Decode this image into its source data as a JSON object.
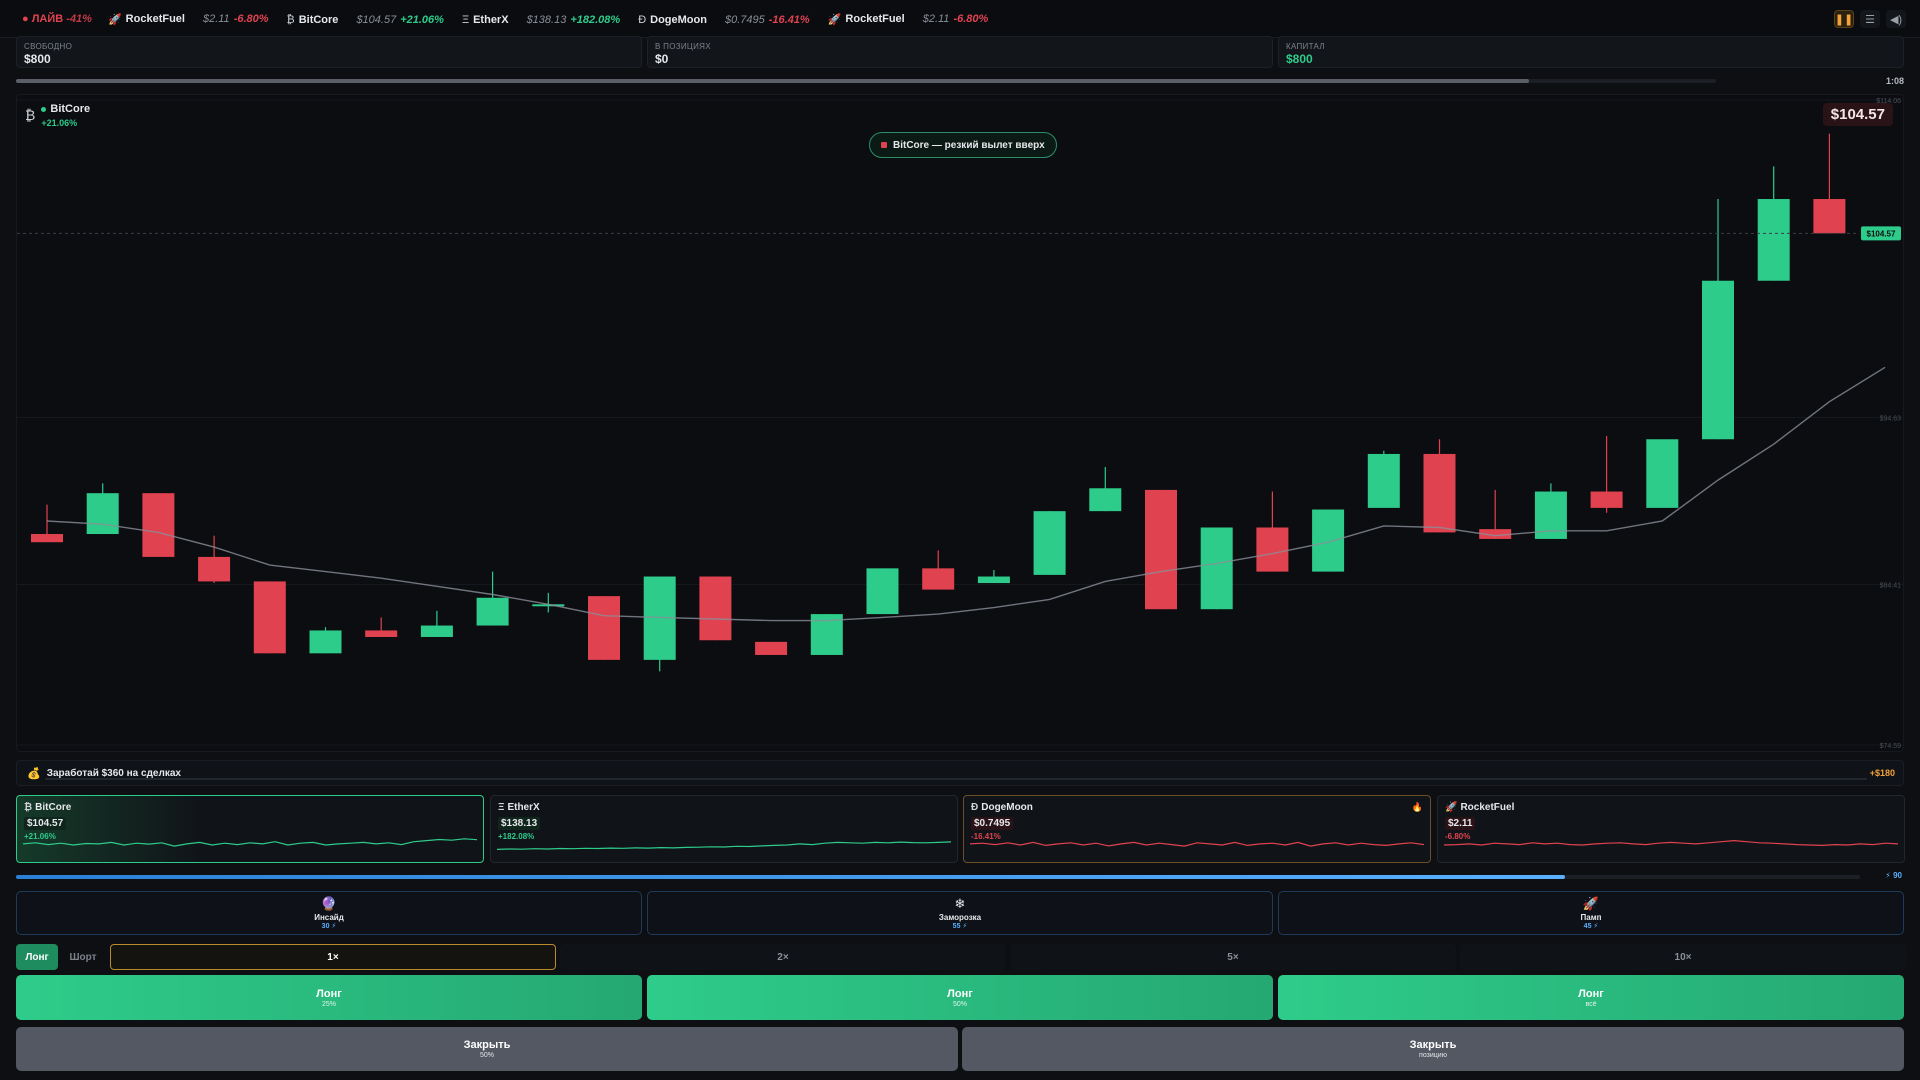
{
  "ticker": {
    "live_label": "● ЛАЙВ",
    "live_pct": "-41%",
    "items": [
      {
        "icon": "rocket-icon",
        "glyph": "🚀",
        "name": "RocketFuel",
        "price": "$2.11",
        "change": "-6.80%",
        "dir": "neg"
      },
      {
        "icon": "bitcore-icon",
        "glyph": "₿",
        "name": "BitCore",
        "price": "$104.57",
        "change": "+21.06%",
        "dir": "pos"
      },
      {
        "icon": "etherx-icon",
        "glyph": "Ξ",
        "name": "EtherX",
        "price": "$138.13",
        "change": "+182.08%",
        "dir": "pos"
      },
      {
        "icon": "dogemoon-icon",
        "glyph": "Ð",
        "name": "DogeMoon",
        "price": "$0.7495",
        "change": "-16.41%",
        "dir": "neg"
      },
      {
        "icon": "rocket-icon",
        "glyph": "🚀",
        "name": "RocketFuel",
        "price": "$2.11",
        "change": "-6.80%",
        "dir": "neg"
      }
    ]
  },
  "stats": {
    "free": {
      "label": "СВОБОДНО",
      "value": "$800"
    },
    "positions": {
      "label": "В ПОЗИЦИЯХ",
      "value": "$0"
    },
    "capital": {
      "label": "КАПИТАЛ",
      "value": "$800"
    }
  },
  "timer": "1:08",
  "round_progress": 0.89,
  "chart": {
    "asset_symbol": "₿",
    "asset_name": "BitCore",
    "asset_change": "+21.06%",
    "current_price": "$104.57",
    "current_price_tag": "$104.57",
    "news": "BitCore — резкий вылет вверх",
    "colors": {
      "up": "#2ecc8a",
      "down": "#e0434f",
      "ma": "#8a8f98"
    }
  },
  "chart_data": {
    "type": "candlestick",
    "y_ticks": [
      "$114.06",
      "$94.63",
      "$84.41",
      "$74.59"
    ],
    "y_tick_values": [
      114.06,
      94.63,
      84.41,
      74.59
    ],
    "ylim": [
      74.59,
      114.06
    ],
    "candles": [
      {
        "o": 87.5,
        "h": 89.3,
        "l": 87.0,
        "c": 87.0
      },
      {
        "o": 87.5,
        "h": 90.6,
        "l": 87.5,
        "c": 90.0
      },
      {
        "o": 90.0,
        "h": 90.0,
        "l": 86.1,
        "c": 86.1
      },
      {
        "o": 86.1,
        "h": 87.4,
        "l": 84.5,
        "c": 84.6
      },
      {
        "o": 84.6,
        "h": 84.6,
        "l": 80.2,
        "c": 80.2
      },
      {
        "o": 80.2,
        "h": 81.8,
        "l": 80.2,
        "c": 81.6
      },
      {
        "o": 81.6,
        "h": 82.4,
        "l": 81.2,
        "c": 81.2
      },
      {
        "o": 81.2,
        "h": 82.8,
        "l": 81.2,
        "c": 81.9
      },
      {
        "o": 81.9,
        "h": 85.2,
        "l": 81.9,
        "c": 83.6
      },
      {
        "o": 83.1,
        "h": 83.9,
        "l": 82.7,
        "c": 83.2
      },
      {
        "o": 83.7,
        "h": 83.7,
        "l": 79.8,
        "c": 79.8
      },
      {
        "o": 79.8,
        "h": 84.9,
        "l": 79.1,
        "c": 84.9
      },
      {
        "o": 84.9,
        "h": 84.9,
        "l": 81.0,
        "c": 81.0
      },
      {
        "o": 80.9,
        "h": 80.9,
        "l": 80.1,
        "c": 80.1
      },
      {
        "o": 80.1,
        "h": 82.6,
        "l": 80.1,
        "c": 82.6
      },
      {
        "o": 82.6,
        "h": 85.4,
        "l": 82.6,
        "c": 85.4
      },
      {
        "o": 85.4,
        "h": 86.5,
        "l": 84.1,
        "c": 84.1
      },
      {
        "o": 84.5,
        "h": 85.3,
        "l": 84.5,
        "c": 84.9
      },
      {
        "o": 85.0,
        "h": 88.9,
        "l": 85.0,
        "c": 88.9
      },
      {
        "o": 88.9,
        "h": 91.6,
        "l": 88.9,
        "c": 90.3
      },
      {
        "o": 90.2,
        "h": 90.2,
        "l": 82.9,
        "c": 82.9
      },
      {
        "o": 82.9,
        "h": 87.9,
        "l": 82.9,
        "c": 87.9
      },
      {
        "o": 87.9,
        "h": 90.1,
        "l": 85.2,
        "c": 85.2
      },
      {
        "o": 85.2,
        "h": 89.0,
        "l": 85.2,
        "c": 89.0
      },
      {
        "o": 89.1,
        "h": 92.6,
        "l": 89.1,
        "c": 92.4
      },
      {
        "o": 92.4,
        "h": 93.3,
        "l": 87.6,
        "c": 87.6
      },
      {
        "o": 87.8,
        "h": 90.2,
        "l": 87.2,
        "c": 87.2
      },
      {
        "o": 87.2,
        "h": 90.6,
        "l": 87.2,
        "c": 90.1
      },
      {
        "o": 90.1,
        "h": 93.5,
        "l": 88.8,
        "c": 89.1
      },
      {
        "o": 89.1,
        "h": 93.0,
        "l": 89.1,
        "c": 93.3
      },
      {
        "o": 93.3,
        "h": 108.0,
        "l": 93.3,
        "c": 103.0
      },
      {
        "o": 103.0,
        "h": 110.0,
        "l": 103.0,
        "c": 108.0
      },
      {
        "o": 108.0,
        "h": 112.0,
        "l": 105.9,
        "c": 105.9
      }
    ],
    "moving_average": [
      88.3,
      88.1,
      87.6,
      86.7,
      85.6,
      85.2,
      84.8,
      84.3,
      83.8,
      83.2,
      82.5,
      82.4,
      82.3,
      82.2,
      82.2,
      82.4,
      82.6,
      83.0,
      83.5,
      84.6,
      85.2,
      85.7,
      86.3,
      87.0,
      88.0,
      87.9,
      87.4,
      87.7,
      87.7,
      88.3,
      90.8,
      93.0,
      95.6,
      97.7
    ]
  },
  "quest": {
    "icon": "money-bag-icon",
    "glyph": "💰",
    "text": "Заработай $360 на сделках",
    "reward": "+$180",
    "progress": 0.0
  },
  "cards": [
    {
      "symbol": "₿",
      "name": "BitCore",
      "price": "$104.57",
      "change": "+21.06%",
      "dir": "pos",
      "sparkline": [
        0.55,
        0.6,
        0.52,
        0.58,
        0.5,
        0.57,
        0.55,
        0.62,
        0.5,
        0.58,
        0.54,
        0.6,
        0.45,
        0.55,
        0.62,
        0.5,
        0.58,
        0.52,
        0.6,
        0.55,
        0.65,
        0.5,
        0.58,
        0.62,
        0.5,
        0.55,
        0.58,
        0.62,
        0.55,
        0.6,
        0.52,
        0.65,
        0.7,
        0.75,
        0.72,
        0.78,
        0.74
      ]
    },
    {
      "symbol": "Ξ",
      "name": "EtherX",
      "price": "$138.13",
      "change": "+182.08%",
      "dir": "pos",
      "sparkline": [
        0.3,
        0.32,
        0.31,
        0.33,
        0.32,
        0.34,
        0.33,
        0.35,
        0.34,
        0.36,
        0.35,
        0.37,
        0.36,
        0.38,
        0.37,
        0.39,
        0.4,
        0.42,
        0.41,
        0.44,
        0.43,
        0.46,
        0.48,
        0.5,
        0.55,
        0.52,
        0.58,
        0.62,
        0.6,
        0.58,
        0.62,
        0.6,
        0.63,
        0.61,
        0.6,
        0.62,
        0.64
      ]
    },
    {
      "symbol": "Ð",
      "name": "DogeMoon",
      "price": "$0.7495",
      "change": "-16.41%",
      "dir": "neg",
      "hot": true,
      "sparkline": [
        0.55,
        0.58,
        0.52,
        0.6,
        0.5,
        0.62,
        0.48,
        0.55,
        0.6,
        0.5,
        0.58,
        0.46,
        0.55,
        0.62,
        0.5,
        0.58,
        0.52,
        0.45,
        0.6,
        0.55,
        0.5,
        0.62,
        0.48,
        0.55,
        0.58,
        0.5,
        0.62,
        0.45,
        0.55,
        0.6,
        0.5,
        0.58,
        0.52,
        0.48,
        0.55,
        0.6,
        0.52
      ]
    },
    {
      "symbol": "🚀",
      "name": "RocketFuel",
      "price": "$2.11",
      "change": "-6.80%",
      "dir": "neg",
      "sparkline": [
        0.5,
        0.52,
        0.55,
        0.5,
        0.58,
        0.55,
        0.52,
        0.6,
        0.55,
        0.58,
        0.52,
        0.5,
        0.55,
        0.58,
        0.6,
        0.55,
        0.52,
        0.58,
        0.62,
        0.58,
        0.55,
        0.6,
        0.65,
        0.7,
        0.65,
        0.6,
        0.58,
        0.55,
        0.52,
        0.5,
        0.48,
        0.52,
        0.5,
        0.55,
        0.52,
        0.58,
        0.55
      ]
    }
  ],
  "energy": {
    "value": 0.84,
    "label": "⚡ 90"
  },
  "powerups": [
    {
      "icon": "crystal-ball-icon",
      "glyph": "🔮",
      "name": "Инсайд",
      "cost": "30 ⚡"
    },
    {
      "icon": "snowflake-icon",
      "glyph": "❄",
      "name": "Заморозка",
      "cost": "55 ⚡"
    },
    {
      "icon": "rocket-icon",
      "glyph": "🚀",
      "name": "Памп",
      "cost": "45 ⚡"
    }
  ],
  "direction": {
    "long": "Лонг",
    "short": "Шорт"
  },
  "leverage": [
    "1×",
    "2×",
    "5×",
    "10×"
  ],
  "actions": [
    {
      "label": "Лонг",
      "sub": "25%"
    },
    {
      "label": "Лонг",
      "sub": "50%"
    },
    {
      "label": "Лонг",
      "sub": "всё"
    }
  ],
  "close": [
    {
      "label": "Закрыть",
      "sub": "50%"
    },
    {
      "label": "Закрыть",
      "sub": "позицию"
    }
  ]
}
